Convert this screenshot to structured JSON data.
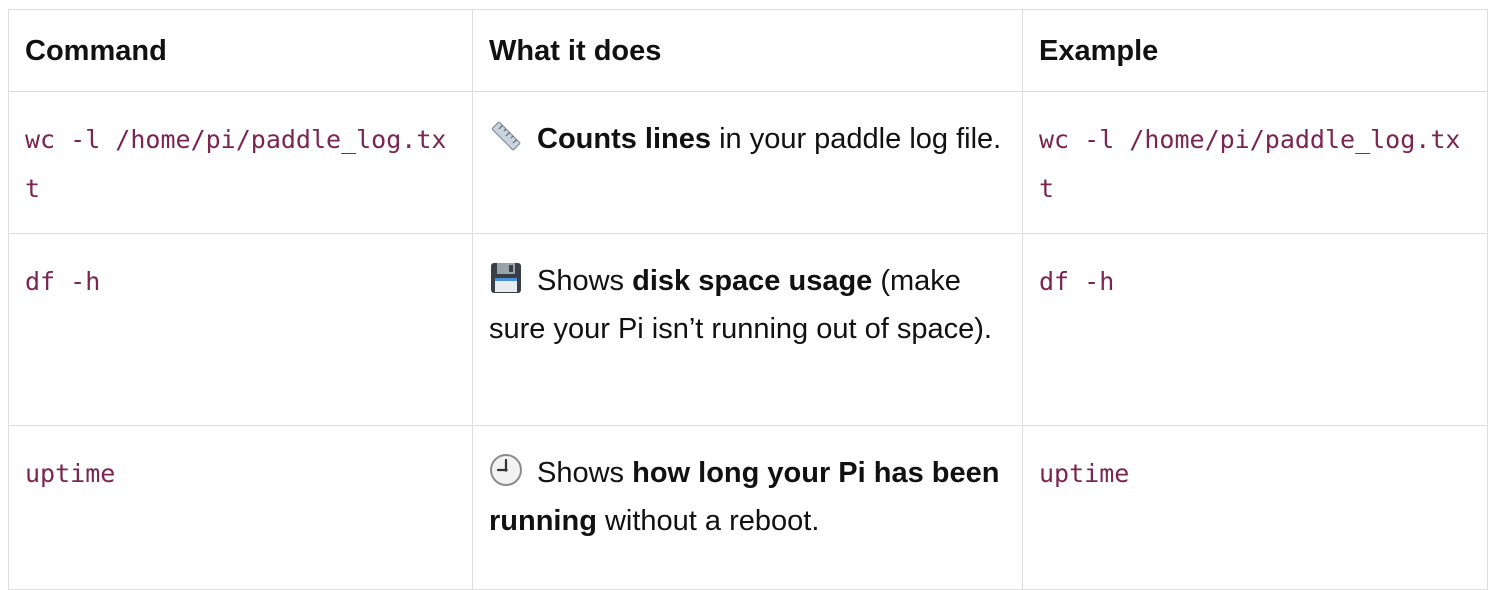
{
  "table": {
    "headers": [
      "Command",
      "What it does",
      "Example"
    ],
    "rows": [
      {
        "command": "wc -l /home/pi/paddle_log.txt",
        "icon": "ruler-icon",
        "desc_pre": "",
        "desc_bold": "Counts lines",
        "desc_post": " in your paddle log file.",
        "example": "wc -l /home/pi/paddle_log.txt"
      },
      {
        "command": "df -h",
        "icon": "floppy-disk-icon",
        "desc_pre": "Shows ",
        "desc_bold": "disk space usage",
        "desc_post": " (make sure your Pi isn’t running out of space).",
        "example": "df -h"
      },
      {
        "command": "uptime",
        "icon": "clock-icon",
        "desc_pre": "Shows ",
        "desc_bold": "how long your Pi has been running",
        "desc_post": " without a reboot.",
        "example": "uptime"
      }
    ]
  },
  "colors": {
    "code": "#7b2550",
    "border": "#dcdcdc",
    "text": "#111111"
  }
}
